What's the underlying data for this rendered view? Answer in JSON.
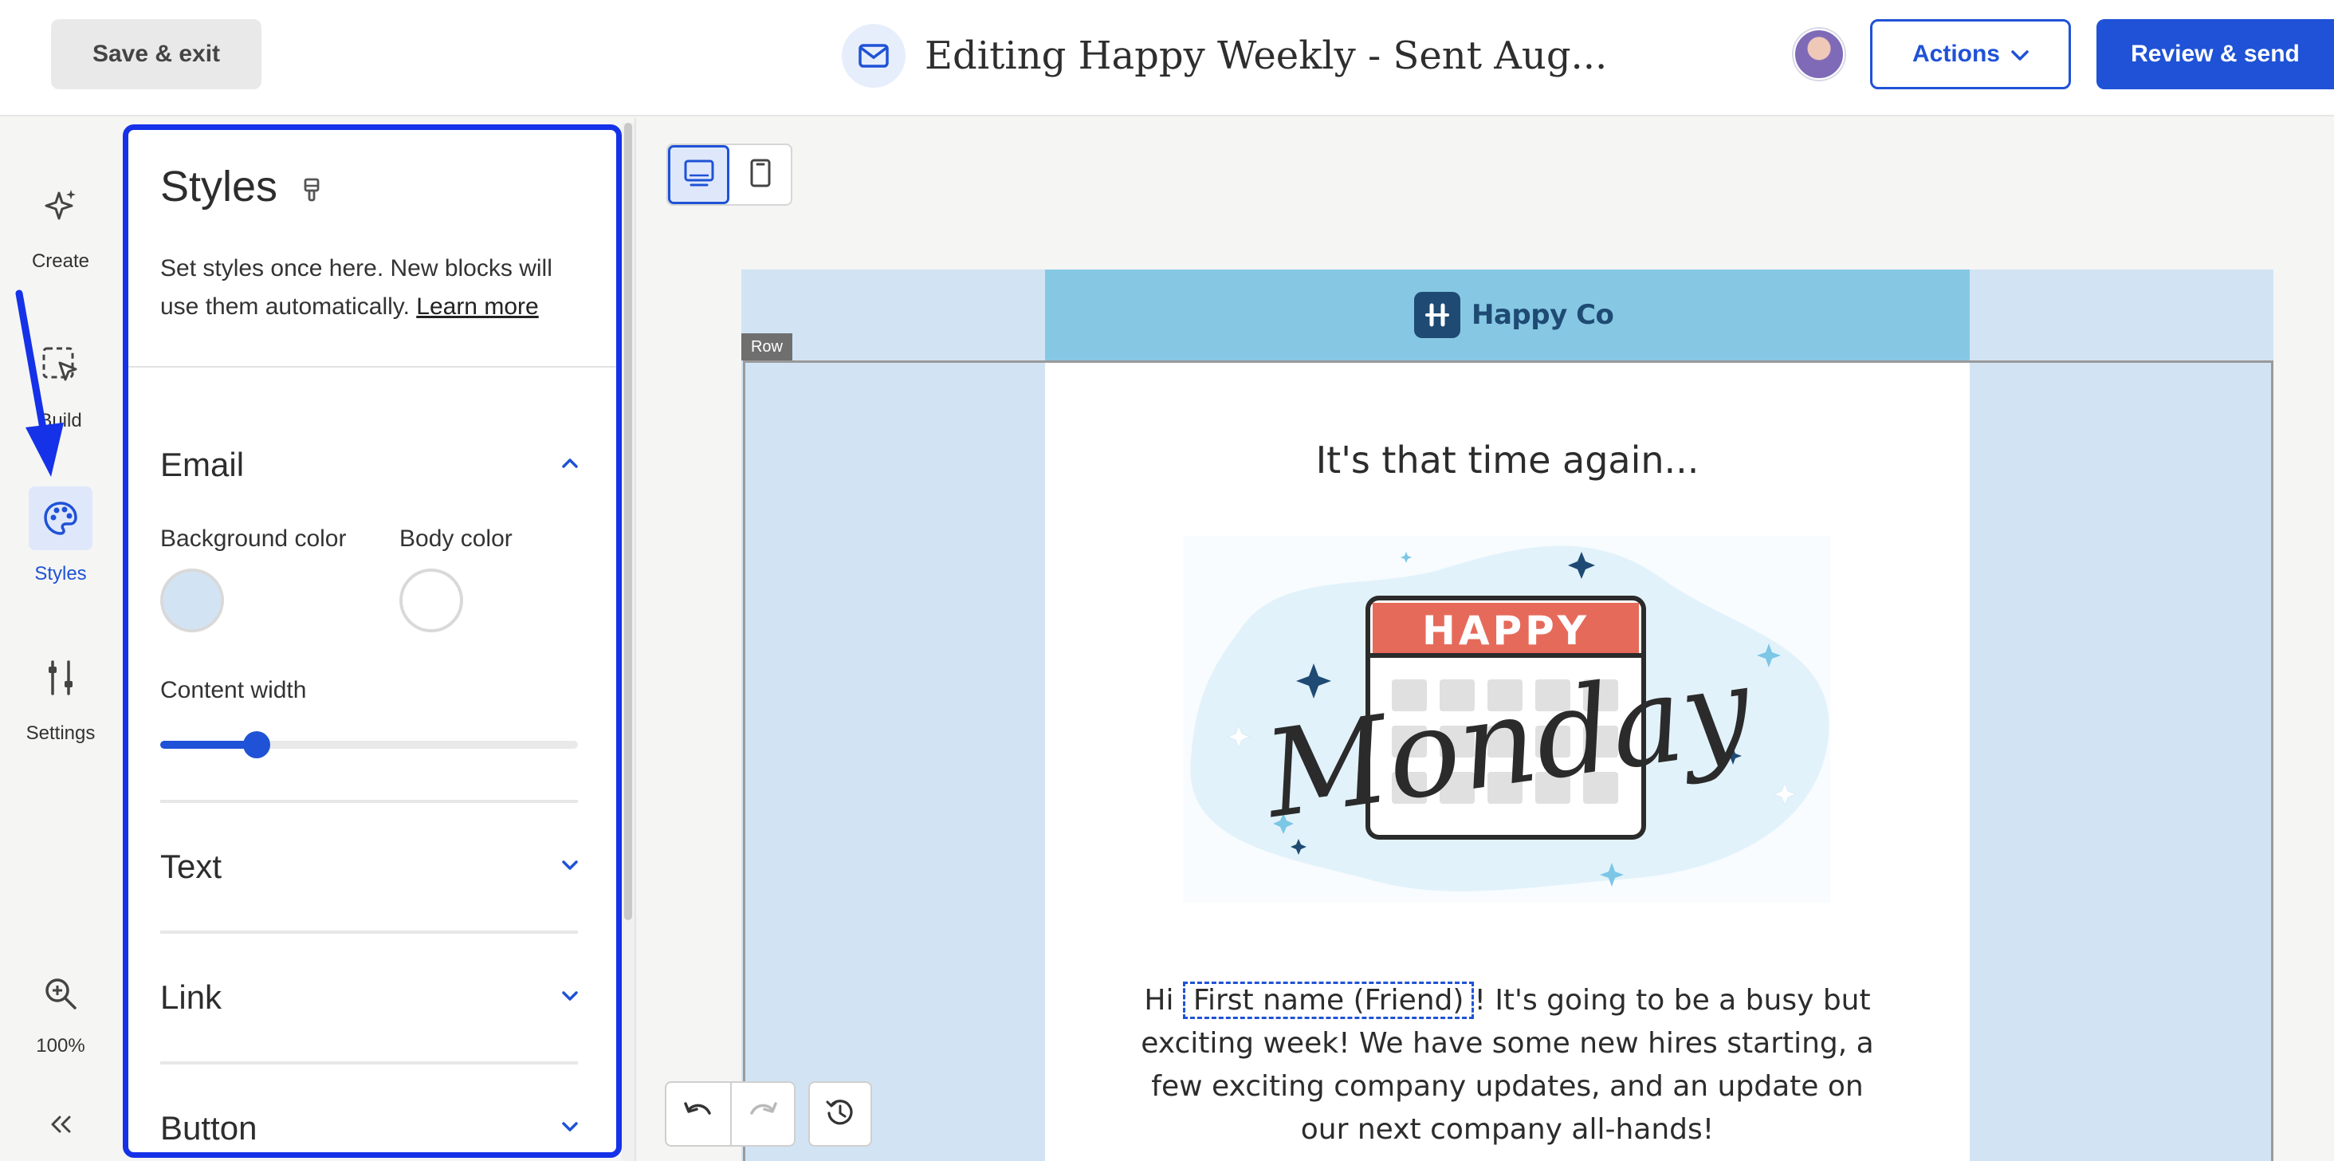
{
  "topbar": {
    "save_exit_label": "Save & exit",
    "title": "Editing Happy Weekly - Sent Aug...",
    "actions_label": "Actions",
    "review_send_label": "Review & send"
  },
  "rail": {
    "items": [
      {
        "label": "Create",
        "icon": "sparkle-icon"
      },
      {
        "label": "Build",
        "icon": "select-cursor-icon"
      },
      {
        "label": "Styles",
        "icon": "palette-icon",
        "active": true
      },
      {
        "label": "Settings",
        "icon": "sliders-icon"
      }
    ],
    "zoom_label": "100%"
  },
  "panel": {
    "title": "Styles",
    "description": "Set styles once here. New blocks will use them automatically.",
    "learn_more": "Learn more",
    "sections": {
      "email": {
        "title": "Email",
        "background_color_label": "Background color",
        "background_color": "#d2e4f4",
        "body_color_label": "Body color",
        "body_color": "#ffffff",
        "content_width_label": "Content width",
        "content_width_fraction": 0.23
      },
      "text": {
        "title": "Text"
      },
      "link": {
        "title": "Link"
      },
      "button": {
        "title": "Button"
      }
    }
  },
  "email": {
    "brand": "Happy Co",
    "row_tag": "Row",
    "headline": "It's that time again...",
    "hero_top_text": "HAPPY",
    "hero_script_text": "Monday",
    "body_before": "Hi ",
    "merge_tag": "First name (Friend)",
    "body_after": "! It's going to be a busy but exciting week! We have some new hires starting, a few exciting company updates, and an update on our next company all-hands!"
  },
  "colors": {
    "accent": "#1f52d6",
    "highlight_border": "#1532e8",
    "email_background": "#d2e4f4",
    "header_band": "#86c8e3"
  }
}
